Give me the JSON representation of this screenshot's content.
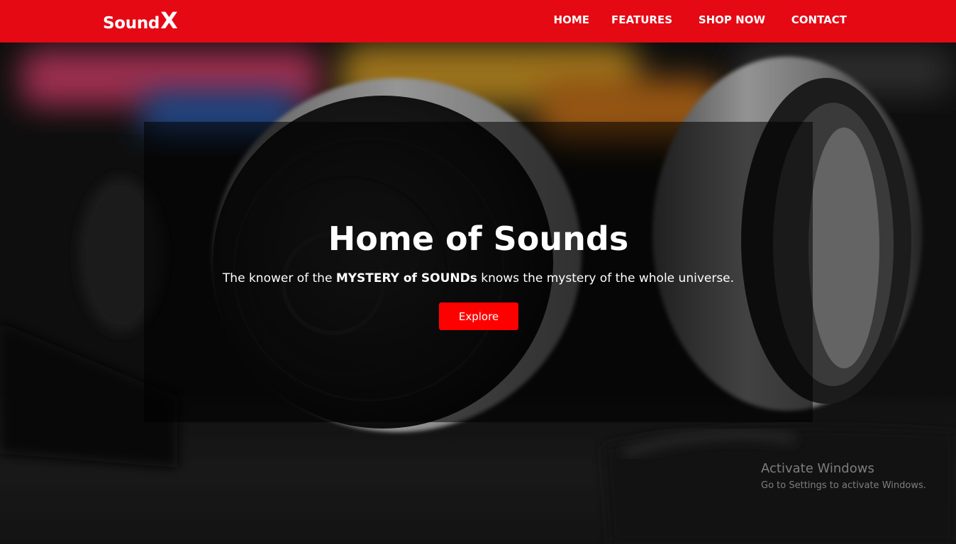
{
  "brand": {
    "name_main": "Sound",
    "name_accent": "X"
  },
  "nav": {
    "items": [
      {
        "label": "HOME"
      },
      {
        "label": "FEATURES"
      },
      {
        "label": "SHOP NOW"
      },
      {
        "label": "CONTACT"
      }
    ]
  },
  "hero": {
    "title": "Home of Sounds",
    "subtitle_before": "The knower of the ",
    "subtitle_bold": "MYSTERY of SOUNDs",
    "subtitle_after": " knows the mystery of the whole universe.",
    "button_label": "Explore"
  },
  "watermark": {
    "title": "Activate Windows",
    "subtitle": "Go to Settings to activate Windows."
  },
  "colors": {
    "navbar": "#e50914",
    "button": "#ff0000",
    "text": "#ffffff"
  },
  "icons": {
    "background_image": "headphones-photo"
  }
}
